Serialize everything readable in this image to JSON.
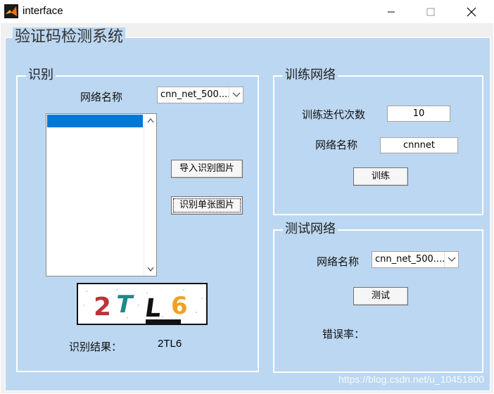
{
  "window": {
    "title": "interface"
  },
  "main": {
    "title": "验证码检测系统"
  },
  "recognize": {
    "group_title": "识别",
    "network_label": "网络名称",
    "network_selected": "cnn_net_500....",
    "import_button": "导入识别图片",
    "recognize_button": "识别单张图片",
    "captcha_chars": [
      "2",
      "T",
      "L",
      "6"
    ],
    "result_label": "识别结果：",
    "result_value": "2TL6"
  },
  "train": {
    "group_title": "训练网络",
    "iterations_label": "训练迭代次数",
    "iterations_value": "10",
    "network_label": "网络名称",
    "network_value": "cnnnet",
    "train_button": "训练"
  },
  "test": {
    "group_title": "测试网络",
    "network_label": "网络名称",
    "network_selected": "cnn_net_500....",
    "test_button": "测试",
    "error_label": "错误率："
  },
  "watermark": "https://blog.csdn.net/u_10451800",
  "colors": {
    "panel_bg": "#bcd7f1",
    "selection": "#0078d7",
    "captcha_colors": [
      "#b7353a",
      "#1e8a8a",
      "#111111",
      "#f0a020"
    ]
  }
}
